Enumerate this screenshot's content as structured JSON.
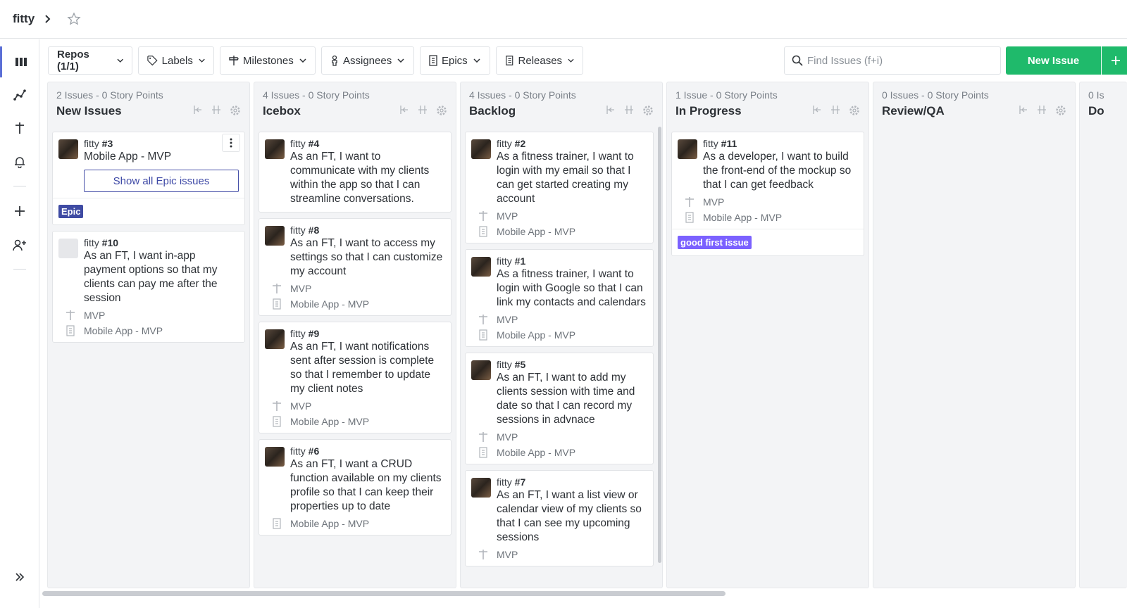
{
  "header": {
    "workspace": "fitty"
  },
  "toolbar": {
    "repos": "Repos (1/1)",
    "labels": "Labels",
    "milestones": "Milestones",
    "assignees": "Assignees",
    "epics": "Epics",
    "releases": "Releases",
    "search_placeholder": "Find Issues (f+i)",
    "new_issue": "New Issue"
  },
  "pipelines": [
    {
      "count": "2 Issues",
      "points": "0 Story Points",
      "name": "New Issues",
      "epic_card": {
        "repo": "fitty",
        "number": "#3",
        "title": "Mobile App - MVP",
        "button": "Show all Epic issues",
        "label": "Epic",
        "label_color": "#3f4ba3"
      },
      "cards": [
        {
          "repo": "fitty",
          "number": "#10",
          "title": "As an FT, I want in-app payment options so that my clients can pay me after the session",
          "milestone": "MVP",
          "epic": "Mobile App - MVP"
        }
      ]
    },
    {
      "count": "4 Issues",
      "points": "0 Story Points",
      "name": "Icebox",
      "cards": [
        {
          "repo": "fitty",
          "number": "#4",
          "title": "As an FT, I want to communicate with my clients within the app so that I can streamline conversations."
        },
        {
          "repo": "fitty",
          "number": "#8",
          "title": "As an FT, I want to access my settings so that I can customize my account",
          "milestone": "MVP",
          "epic": "Mobile App - MVP"
        },
        {
          "repo": "fitty",
          "number": "#9",
          "title": "As an FT, I want notifications sent after session is complete so that I remember to update my client notes",
          "milestone": "MVP",
          "epic": "Mobile App - MVP"
        },
        {
          "repo": "fitty",
          "number": "#6",
          "title": "As an FT, I want a CRUD function available on my clients profile so that I can keep their properties up to date",
          "epic": "Mobile App - MVP"
        }
      ]
    },
    {
      "count": "4 Issues",
      "points": "0 Story Points",
      "name": "Backlog",
      "cards": [
        {
          "repo": "fitty",
          "number": "#2",
          "title": "As a fitness trainer, I want to login with my email so that I can get started creating my account",
          "milestone": "MVP",
          "epic": "Mobile App - MVP"
        },
        {
          "repo": "fitty",
          "number": "#1",
          "title": "As a fitness trainer, I want to login with Google so that I can link my contacts and calendars",
          "milestone": "MVP",
          "epic": "Mobile App - MVP"
        },
        {
          "repo": "fitty",
          "number": "#5",
          "title": "As an FT, I want to add my clients session with time and date so that I can record my sessions in advnace",
          "milestone": "MVP",
          "epic": "Mobile App - MVP"
        },
        {
          "repo": "fitty",
          "number": "#7",
          "title": "As an FT, I want a list view or calendar view of my clients so that I can see my upcoming sessions",
          "milestone": "MVP"
        }
      ]
    },
    {
      "count": "1 Issue",
      "points": "0 Story Points",
      "name": "In Progress",
      "cards": [
        {
          "repo": "fitty",
          "number": "#11",
          "title": "As a developer, I want to build the front-end of the mockup so that I can get feedback",
          "milestone": "MVP",
          "epic": "Mobile App - MVP",
          "label": "good first issue",
          "label_color": "#7b61ff"
        }
      ]
    },
    {
      "count": "0 Issues",
      "points": "0 Story Points",
      "name": "Review/QA",
      "cards": []
    },
    {
      "count": "0 Is",
      "name": "Do",
      "cards": []
    }
  ]
}
